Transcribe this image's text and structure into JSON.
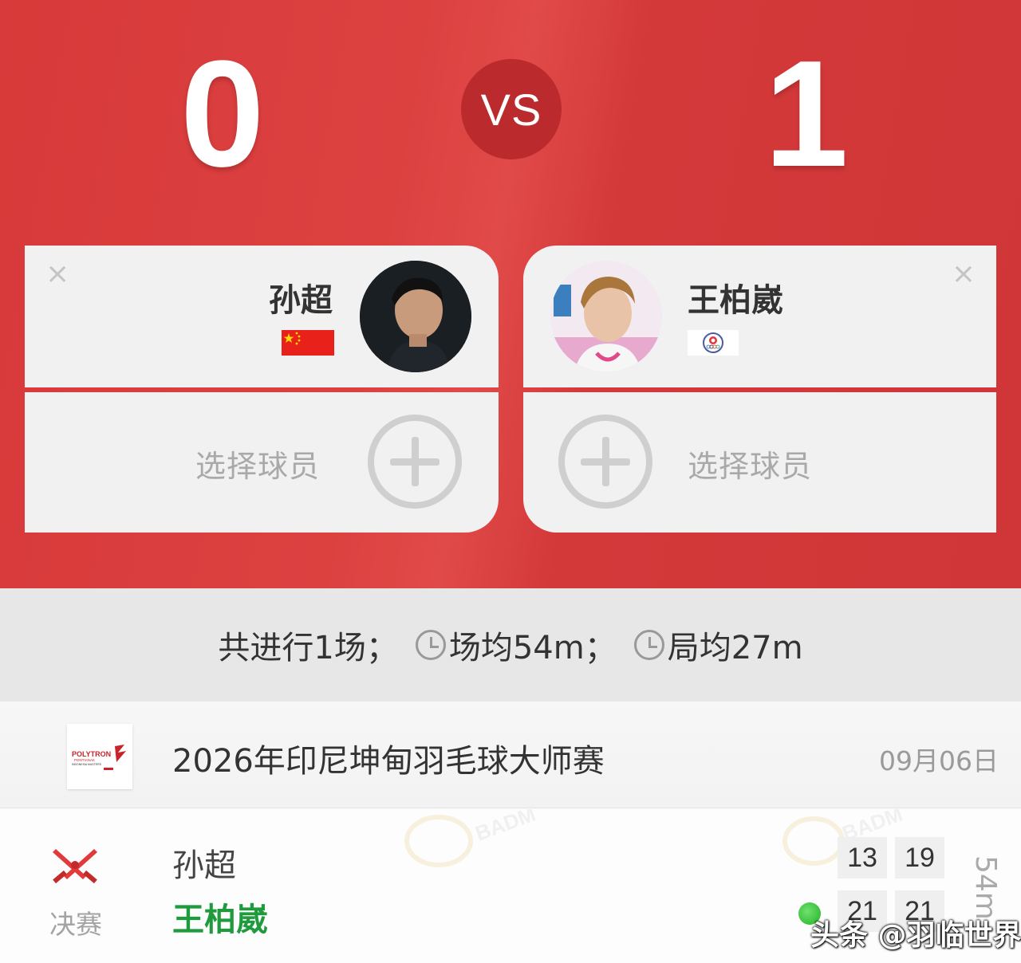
{
  "header": {
    "left_score": "0",
    "right_score": "1",
    "vs_label": "VS"
  },
  "players": {
    "left": {
      "name": "孙超",
      "close_icon": "×",
      "flag": "china-flag"
    },
    "right": {
      "name": "王柏崴",
      "close_icon": "×",
      "flag": "chinese-taipei-olympic-flag"
    }
  },
  "add_player": {
    "left_label": "选择球员",
    "right_label": "选择球员"
  },
  "stats": {
    "matches": "共进行1场；",
    "avg_match": "场均54m；",
    "avg_game": "局均27m"
  },
  "tournament": {
    "name": "2026年印尼坤甸羽毛球大师赛",
    "date": "09月06日",
    "logo_text": "POLYTRON",
    "logo_sub1": "PONTIANAK",
    "logo_sub2": "INDONESIA MASTERS"
  },
  "match": {
    "round": "决赛",
    "player1": "孙超",
    "player2": "王柏崴",
    "player1_games": [
      "13",
      "19"
    ],
    "player2_games": [
      "21",
      "21"
    ],
    "duration": "54m",
    "winner": "player2"
  },
  "watermark": "头条 @羽临世界",
  "colors": {
    "header_red": "#d8393a",
    "vs_circle": "#bb2b2d",
    "winner_green": "#1f9a3c"
  }
}
